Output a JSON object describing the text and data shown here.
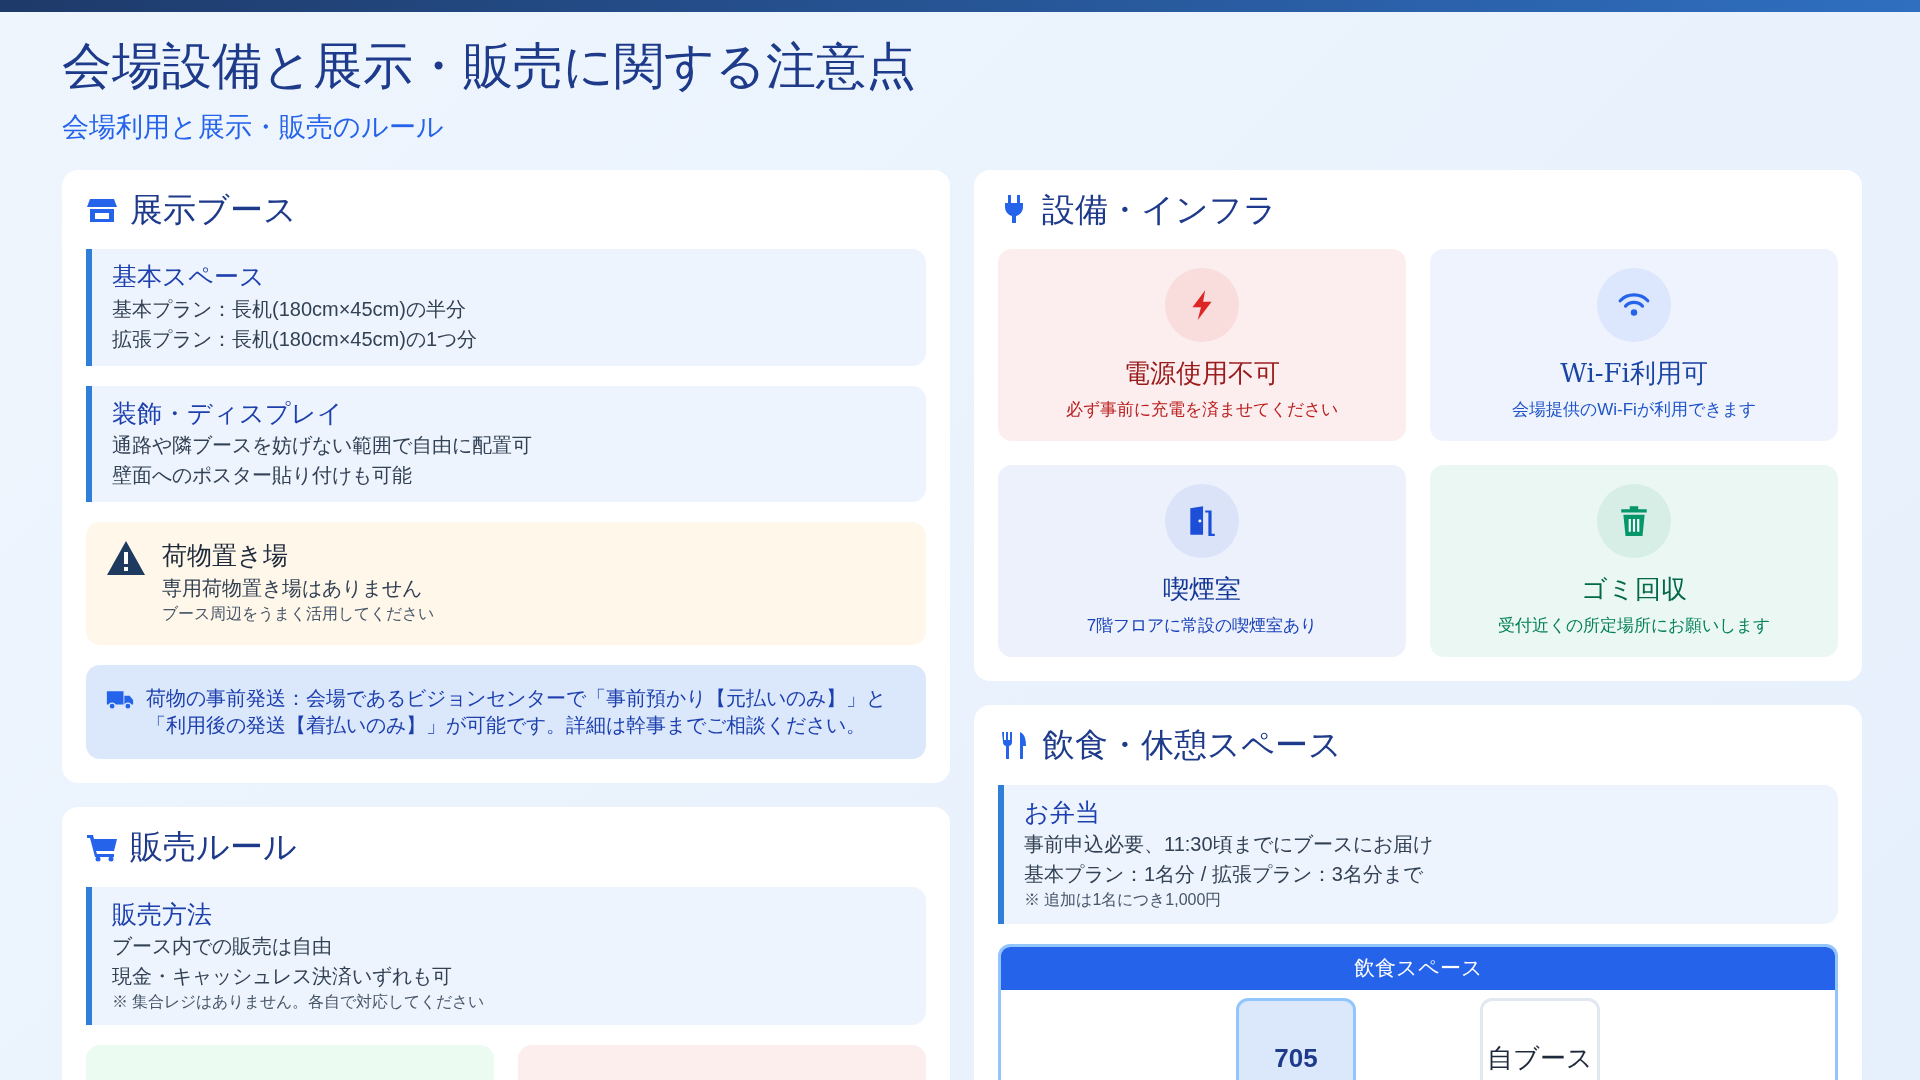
{
  "title": "会場設備と展示・販売に関する注意点",
  "subtitle": "会場利用と展示・販売のルール",
  "booth": {
    "heading": "展示ブース",
    "items": [
      {
        "kind": "rule",
        "title": "基本スペース",
        "lines": [
          "基本プラン：長机(180cm×45cm)の半分",
          "拡張プラン：長机(180cm×45cm)の1つ分"
        ]
      },
      {
        "kind": "rule",
        "title": "装飾・ディスプレイ",
        "lines": [
          "通路や隣ブースを妨げない範囲で自由に配置可",
          "壁面へのポスター貼り付けも可能"
        ]
      },
      {
        "kind": "warning",
        "title": "荷物置き場",
        "lines": [
          "専用荷物置き場はありません"
        ],
        "note": "ブース周辺をうまく活用してください"
      },
      {
        "kind": "notice",
        "text": "荷物の事前発送：会場であるビジョンセンターで「事前預かり【元払いのみ】」と「利用後の発送【着払いのみ】」が可能です。詳細は幹事までご相談ください。"
      }
    ]
  },
  "sales": {
    "heading": "販売ルール",
    "items": [
      {
        "kind": "rule",
        "title": "販売方法",
        "lines": [
          "ブース内での販売は自由",
          "現金・キャッシュレス決済いずれも可"
        ],
        "note": "※ 集合レジはありません。各自で対応してください"
      }
    ],
    "tiles": [
      {
        "color": "#ebfbf2"
      },
      {
        "color": "#fdeeee"
      }
    ]
  },
  "facilities": {
    "heading": "設備・インフラ",
    "tiles": [
      {
        "color": "#dc2626",
        "title": "電源使用不可",
        "text": "必ず事前に充電を済ませてください"
      },
      {
        "color": "#2563eb",
        "title": "Wi-Fi利用可",
        "text": "会場提供のWi-Fiが利用できます"
      },
      {
        "color": "#1d4ed8",
        "title": "喫煙室",
        "text": "7階フロアに常設の喫煙室あり"
      },
      {
        "color": "#059669",
        "title": "ゴミ回収",
        "text": "受付近くの所定場所にお願いします"
      }
    ]
  },
  "dining": {
    "heading": "飲食・休憩スペース",
    "items": [
      {
        "kind": "rule",
        "title": "お弁当",
        "lines": [
          "事前申込必要、11:30頃までにブースにお届け",
          "基本プラン：1名分 / 拡張プラン：3名分まで"
        ],
        "note": "※ 追加は1名につき1,000円"
      }
    ],
    "map": {
      "title": "飲食スペース",
      "rooms": [
        {
          "label": "705",
          "highlight": true
        },
        {
          "label": "自ブース",
          "highlight": false
        }
      ]
    }
  }
}
